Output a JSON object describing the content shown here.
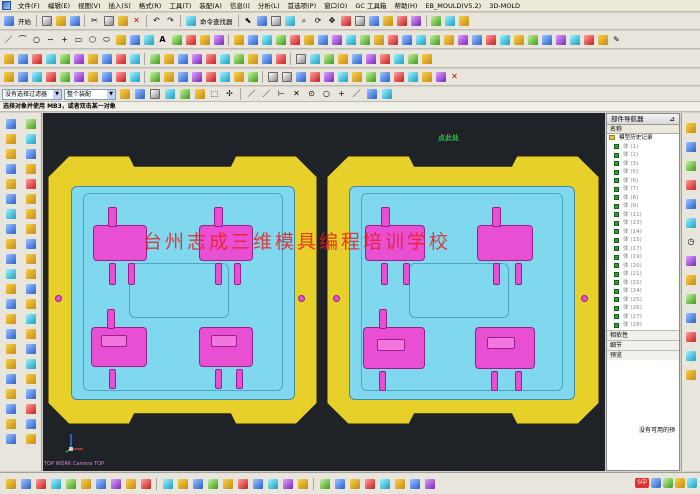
{
  "menubar": {
    "items": [
      "文件(F)",
      "编辑(E)",
      "视图(V)",
      "插入(S)",
      "格式(R)",
      "工具(T)",
      "装配(A)",
      "信息(I)",
      "分析(L)",
      "首选项(P)",
      "窗口(O)",
      "GC 工具箱",
      "帮助(H)",
      "EB_MOULD(V5.2)",
      "3D-MOLD"
    ]
  },
  "toolbar1": {
    "start_label": "开始",
    "command_finder_label": "命令查找器"
  },
  "filterbar": {
    "type_filter": "没有选择过滤器",
    "assembly_scope": "整个装配"
  },
  "cueline": {
    "text": "选择对象并使用 MB3，或者双击某一对象"
  },
  "viewport": {
    "watermark": "台州志成三维模具编程培训学校",
    "top_label": "点此处",
    "view_name": "TOP WORK Camera TOP",
    "colors": {
      "background": "#1f2226",
      "yellow_plate": "#e8d02a",
      "cyan_cavity": "#7fd8ee",
      "part_magenta": "#e94fd3",
      "watermark_red": "#e81e1e"
    }
  },
  "navigator": {
    "title": "部件导航器",
    "column_name": "名称",
    "root_label": "模型历史记录",
    "rows": [
      "体 (1)",
      "体 (2)",
      "体 (3)",
      "体 (5)",
      "体 (6)",
      "体 (7)",
      "体 (8)",
      "体 (9)",
      "体 (11)",
      "体 (13)",
      "体 (14)",
      "体 (15)",
      "体 (17)",
      "体 (19)",
      "体 (20)",
      "体 (21)",
      "体 (22)",
      "体 (24)",
      "体 (25)",
      "体 (26)",
      "体 (27)",
      "体 (28)"
    ],
    "section_dependencies": "相依性",
    "section_details": "细节",
    "section_preview": "预览",
    "empty_text": "没有可用的预"
  },
  "tray": {
    "ime_label": "S中"
  }
}
